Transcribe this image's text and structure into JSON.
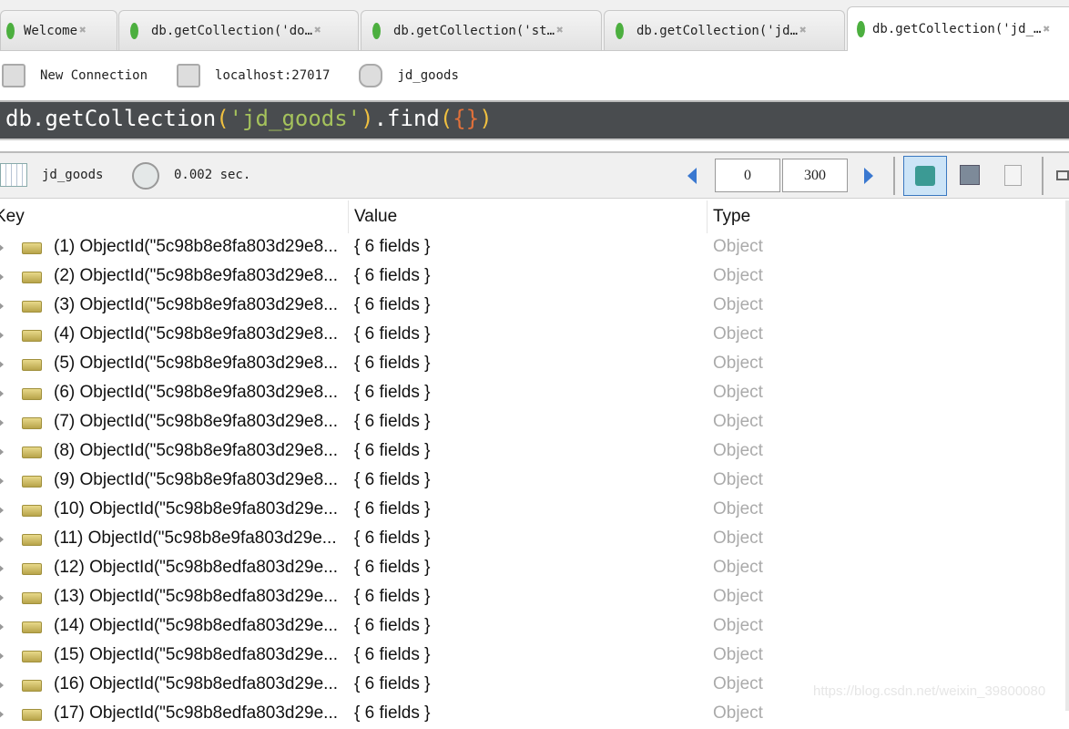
{
  "tabs": [
    {
      "label": "Welcome",
      "icon": "mongodb-leaf-icon"
    },
    {
      "label": "db.getCollection('do…",
      "icon": "mongodb-leaf-icon"
    },
    {
      "label": "db.getCollection('st…",
      "icon": "mongodb-leaf-icon"
    },
    {
      "label": "db.getCollection('jd…",
      "icon": "mongodb-leaf-icon"
    },
    {
      "label": "db.getCollection('jd_…",
      "icon": "mongodb-leaf-icon",
      "active": true
    }
  ],
  "connection": {
    "name": "New Connection",
    "host": "localhost:27017",
    "database": "jd_goods"
  },
  "query": {
    "prefix": "db.getCollection",
    "open": "(",
    "string": "'jd_goods'",
    "close": ")",
    "method": ".find",
    "open2": "(",
    "braces": "{}",
    "close2": ")"
  },
  "results_toolbar": {
    "collection": "jd_goods",
    "time": "0.002 sec.",
    "skip": "0",
    "limit": "300",
    "view_modes": [
      "tree-view-icon",
      "table-view-icon",
      "text-view-icon"
    ],
    "active_view": "tree"
  },
  "columns": {
    "key": "Key",
    "value": "Value",
    "type": "Type"
  },
  "rows": [
    {
      "key": "(1) ObjectId(\"5c98b8e8fa803d29e8...",
      "value": "{ 6 fields }",
      "type": "Object"
    },
    {
      "key": "(2) ObjectId(\"5c98b8e9fa803d29e8...",
      "value": "{ 6 fields }",
      "type": "Object"
    },
    {
      "key": "(3) ObjectId(\"5c98b8e9fa803d29e8...",
      "value": "{ 6 fields }",
      "type": "Object"
    },
    {
      "key": "(4) ObjectId(\"5c98b8e9fa803d29e8...",
      "value": "{ 6 fields }",
      "type": "Object"
    },
    {
      "key": "(5) ObjectId(\"5c98b8e9fa803d29e8...",
      "value": "{ 6 fields }",
      "type": "Object"
    },
    {
      "key": "(6) ObjectId(\"5c98b8e9fa803d29e8...",
      "value": "{ 6 fields }",
      "type": "Object"
    },
    {
      "key": "(7) ObjectId(\"5c98b8e9fa803d29e8...",
      "value": "{ 6 fields }",
      "type": "Object"
    },
    {
      "key": "(8) ObjectId(\"5c98b8e9fa803d29e8...",
      "value": "{ 6 fields }",
      "type": "Object"
    },
    {
      "key": "(9) ObjectId(\"5c98b8e9fa803d29e8...",
      "value": "{ 6 fields }",
      "type": "Object"
    },
    {
      "key": "(10) ObjectId(\"5c98b8e9fa803d29e...",
      "value": "{ 6 fields }",
      "type": "Object"
    },
    {
      "key": "(11) ObjectId(\"5c98b8e9fa803d29e...",
      "value": "{ 6 fields }",
      "type": "Object"
    },
    {
      "key": "(12) ObjectId(\"5c98b8edfa803d29e...",
      "value": "{ 6 fields }",
      "type": "Object"
    },
    {
      "key": "(13) ObjectId(\"5c98b8edfa803d29e...",
      "value": "{ 6 fields }",
      "type": "Object"
    },
    {
      "key": "(14) ObjectId(\"5c98b8edfa803d29e...",
      "value": "{ 6 fields }",
      "type": "Object"
    },
    {
      "key": "(15) ObjectId(\"5c98b8edfa803d29e...",
      "value": "{ 6 fields }",
      "type": "Object"
    },
    {
      "key": "(16) ObjectId(\"5c98b8edfa803d29e...",
      "value": "{ 6 fields }",
      "type": "Object"
    },
    {
      "key": "(17) ObjectId(\"5c98b8edfa803d29e...",
      "value": "{ 6 fields }",
      "type": "Object"
    }
  ],
  "watermark": "https://blog.csdn.net/weixin_39800080"
}
